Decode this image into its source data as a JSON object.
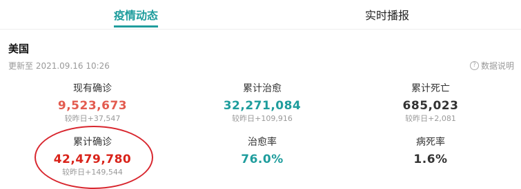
{
  "tabs": [
    {
      "label": "疫情动态"
    },
    {
      "label": "实时播报"
    }
  ],
  "region": "美国",
  "updated": "更新至 2021.09.16 10:26",
  "help_label": "数据说明",
  "stats": {
    "current_confirmed": {
      "label": "现有确诊",
      "value": "9,523,673",
      "delta": "较昨日+37,547"
    },
    "total_cured": {
      "label": "累计治愈",
      "value": "32,271,084",
      "delta": "较昨日+109,916"
    },
    "total_deaths": {
      "label": "累计死亡",
      "value": "685,023",
      "delta": "较昨日+2,081"
    },
    "total_confirmed": {
      "label": "累计确诊",
      "value": "42,479,780",
      "delta": "较昨日+149,544"
    },
    "cure_rate": {
      "label": "治愈率",
      "value": "76.0%"
    },
    "death_rate": {
      "label": "病死率",
      "value": "1.6%"
    }
  },
  "colors": {
    "accent": "#1f9d9d",
    "confirmed": "#e35b4f",
    "total_confirmed": "#d9231a",
    "annotation": "#d8262e"
  }
}
